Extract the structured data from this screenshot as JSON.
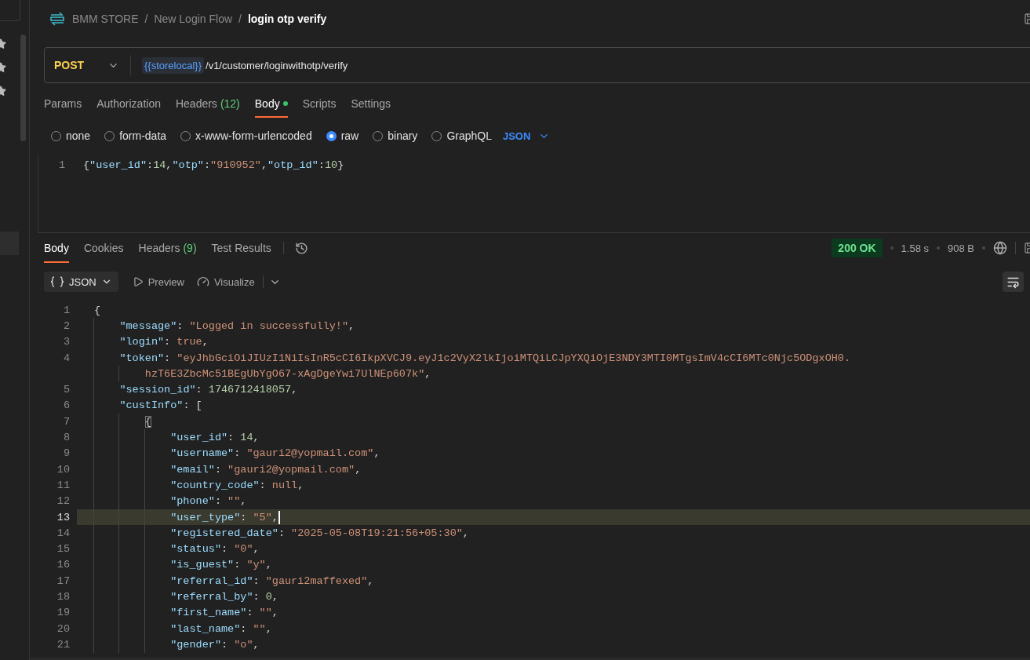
{
  "breadcrumb": [
    {
      "label": "BMM STORE",
      "current": false
    },
    {
      "separator": "/",
      "label": "New Login Flow",
      "current": false
    },
    {
      "separator": "/",
      "label": "login otp verify",
      "current": true
    }
  ],
  "request": {
    "method": "POST",
    "variable": "{{storelocal}}",
    "path": "/v1/customer/loginwithotp/verify"
  },
  "request_tabs": [
    {
      "label": "Params",
      "selected": false,
      "modified": false
    },
    {
      "label": "Authorization",
      "selected": false,
      "modified": false
    },
    {
      "label": "Headers",
      "count": "(12)",
      "selected": false,
      "modified": false
    },
    {
      "label": "Body",
      "selected": true,
      "modified": true
    },
    {
      "label": "Scripts",
      "selected": false,
      "modified": false
    },
    {
      "label": "Settings",
      "selected": false,
      "modified": false
    }
  ],
  "body_types": [
    {
      "label": "none",
      "selected": false
    },
    {
      "label": "form-data",
      "selected": false
    },
    {
      "label": "x-www-form-urlencoded",
      "selected": false
    },
    {
      "label": "raw",
      "selected": true
    },
    {
      "label": "binary",
      "selected": false
    },
    {
      "label": "GraphQL",
      "selected": false
    }
  ],
  "body_format": "JSON",
  "request_body": [
    {
      "number": "1",
      "tokens": [
        {
          "kind": "punct",
          "text": "{"
        },
        {
          "kind": "key",
          "text": "\"user_id\""
        },
        {
          "kind": "punct",
          "text": ":"
        },
        {
          "kind": "number",
          "text": "14"
        },
        {
          "kind": "punct",
          "text": ","
        },
        {
          "kind": "key",
          "text": "\"otp\""
        },
        {
          "kind": "punct",
          "text": ":"
        },
        {
          "kind": "string",
          "text": "\"910952\""
        },
        {
          "kind": "punct",
          "text": ","
        },
        {
          "kind": "key",
          "text": "\"otp_id\""
        },
        {
          "kind": "punct",
          "text": ":"
        },
        {
          "kind": "number",
          "text": "10"
        },
        {
          "kind": "punct",
          "text": "}"
        }
      ]
    }
  ],
  "response_tabs": [
    {
      "label": "Body",
      "selected": true
    },
    {
      "label": "Cookies",
      "selected": false
    },
    {
      "label": "Headers",
      "count": "(9)",
      "selected": false
    },
    {
      "label": "Test Results",
      "selected": false
    }
  ],
  "status": {
    "code": "200 OK",
    "time": "1.58 s",
    "size": "908 B"
  },
  "view": {
    "format": "JSON",
    "preview": "Preview",
    "visualize": "Visualize"
  },
  "response_lines": [
    {
      "number": "1",
      "current": false,
      "tokens": [
        {
          "kind": "punct",
          "text": "{"
        }
      ],
      "children": [
        {
          "number": "2",
          "current": false,
          "tokens": [
            {
              "kind": "key",
              "text": "\"message\""
            },
            {
              "kind": "punct",
              "text": ": "
            },
            {
              "kind": "string",
              "text": "\"Logged in successfully!\""
            },
            {
              "kind": "punct",
              "text": ","
            }
          ]
        },
        {
          "number": "3",
          "current": false,
          "tokens": [
            {
              "kind": "key",
              "text": "\"login\""
            },
            {
              "kind": "punct",
              "text": ": "
            },
            {
              "kind": "literal",
              "text": "true"
            },
            {
              "kind": "punct",
              "text": ","
            }
          ]
        },
        {
          "number": "4",
          "current": false,
          "tokens": [
            {
              "kind": "key",
              "text": "\"token\""
            },
            {
              "kind": "punct",
              "text": ": "
            },
            {
              "kind": "string",
              "text": "\"eyJhbGciOiJIUzI1NiIsInR5cCI6IkpXVCJ9.eyJ1c2VyX2lkIjoiMTQiLCJpYXQiOjE3NDY3MTI0MTgsImV4cCI6MTc0Njc5ODgxOH0."
            }
          ],
          "children": [
            {
              "current": false,
              "tokens": [
                {
                  "kind": "string",
                  "text": "hzT6E3ZbcMc51BEgUbYgO67-xAgDgeYwi7UlNEp607k\""
                },
                {
                  "kind": "punct",
                  "text": ","
                }
              ]
            }
          ]
        },
        {
          "number": "5",
          "current": false,
          "tokens": [
            {
              "kind": "key",
              "text": "\"session_id\""
            },
            {
              "kind": "punct",
              "text": ": "
            },
            {
              "kind": "number",
              "text": "1746712418057"
            },
            {
              "kind": "punct",
              "text": ","
            }
          ]
        },
        {
          "number": "6",
          "current": false,
          "tokens": [
            {
              "kind": "key",
              "text": "\"custInfo\""
            },
            {
              "kind": "punct",
              "text": ": ["
            }
          ],
          "children": [
            {
              "number": "7",
              "current": false,
              "tokens": [
                {
                  "kind": "bracket",
                  "text": "{"
                }
              ],
              "children": [
                {
                  "number": "8",
                  "current": false,
                  "tokens": [
                    {
                      "kind": "key",
                      "text": "\"user_id\""
                    },
                    {
                      "kind": "punct",
                      "text": ": "
                    },
                    {
                      "kind": "number",
                      "text": "14"
                    },
                    {
                      "kind": "punct",
                      "text": ","
                    }
                  ]
                },
                {
                  "number": "9",
                  "current": false,
                  "tokens": [
                    {
                      "kind": "key",
                      "text": "\"username\""
                    },
                    {
                      "kind": "punct",
                      "text": ": "
                    },
                    {
                      "kind": "string",
                      "text": "\"gauri2@yopmail.com\""
                    },
                    {
                      "kind": "punct",
                      "text": ","
                    }
                  ]
                },
                {
                  "number": "10",
                  "current": false,
                  "tokens": [
                    {
                      "kind": "key",
                      "text": "\"email\""
                    },
                    {
                      "kind": "punct",
                      "text": ": "
                    },
                    {
                      "kind": "string",
                      "text": "\"gauri2@yopmail.com\""
                    },
                    {
                      "kind": "punct",
                      "text": ","
                    }
                  ]
                },
                {
                  "number": "11",
                  "current": false,
                  "tokens": [
                    {
                      "kind": "key",
                      "text": "\"country_code\""
                    },
                    {
                      "kind": "punct",
                      "text": ": "
                    },
                    {
                      "kind": "literal",
                      "text": "null"
                    },
                    {
                      "kind": "punct",
                      "text": ","
                    }
                  ]
                },
                {
                  "number": "12",
                  "current": false,
                  "tokens": [
                    {
                      "kind": "key",
                      "text": "\"phone\""
                    },
                    {
                      "kind": "punct",
                      "text": ": "
                    },
                    {
                      "kind": "string",
                      "text": "\"\""
                    },
                    {
                      "kind": "punct",
                      "text": ","
                    }
                  ]
                },
                {
                  "number": "13",
                  "current": true,
                  "tokens": [
                    {
                      "kind": "key",
                      "text": "\"user_type\""
                    },
                    {
                      "kind": "punct",
                      "text": ": "
                    },
                    {
                      "kind": "string",
                      "text": "\"5\""
                    },
                    {
                      "kind": "punct",
                      "text": ","
                    }
                  ]
                },
                {
                  "number": "14",
                  "current": false,
                  "tokens": [
                    {
                      "kind": "key",
                      "text": "\"registered_date\""
                    },
                    {
                      "kind": "punct",
                      "text": ": "
                    },
                    {
                      "kind": "string",
                      "text": "\"2025-05-08T19:21:56+05:30\""
                    },
                    {
                      "kind": "punct",
                      "text": ","
                    }
                  ]
                },
                {
                  "number": "15",
                  "current": false,
                  "tokens": [
                    {
                      "kind": "key",
                      "text": "\"status\""
                    },
                    {
                      "kind": "punct",
                      "text": ": "
                    },
                    {
                      "kind": "string",
                      "text": "\"0\""
                    },
                    {
                      "kind": "punct",
                      "text": ","
                    }
                  ]
                },
                {
                  "number": "16",
                  "current": false,
                  "tokens": [
                    {
                      "kind": "key",
                      "text": "\"is_guest\""
                    },
                    {
                      "kind": "punct",
                      "text": ": "
                    },
                    {
                      "kind": "string",
                      "text": "\"y\""
                    },
                    {
                      "kind": "punct",
                      "text": ","
                    }
                  ]
                },
                {
                  "number": "17",
                  "current": false,
                  "tokens": [
                    {
                      "kind": "key",
                      "text": "\"referral_id\""
                    },
                    {
                      "kind": "punct",
                      "text": ": "
                    },
                    {
                      "kind": "string",
                      "text": "\"gauri2maffexed\""
                    },
                    {
                      "kind": "punct",
                      "text": ","
                    }
                  ]
                },
                {
                  "number": "18",
                  "current": false,
                  "tokens": [
                    {
                      "kind": "key",
                      "text": "\"referral_by\""
                    },
                    {
                      "kind": "punct",
                      "text": ": "
                    },
                    {
                      "kind": "number",
                      "text": "0"
                    },
                    {
                      "kind": "punct",
                      "text": ","
                    }
                  ]
                },
                {
                  "number": "19",
                  "current": false,
                  "tokens": [
                    {
                      "kind": "key",
                      "text": "\"first_name\""
                    },
                    {
                      "kind": "punct",
                      "text": ": "
                    },
                    {
                      "kind": "string",
                      "text": "\"\""
                    },
                    {
                      "kind": "punct",
                      "text": ","
                    }
                  ]
                },
                {
                  "number": "20",
                  "current": false,
                  "tokens": [
                    {
                      "kind": "key",
                      "text": "\"last_name\""
                    },
                    {
                      "kind": "punct",
                      "text": ": "
                    },
                    {
                      "kind": "string",
                      "text": "\"\""
                    },
                    {
                      "kind": "punct",
                      "text": ","
                    }
                  ]
                },
                {
                  "number": "21",
                  "current": false,
                  "tokens": [
                    {
                      "kind": "key",
                      "text": "\"gender\""
                    },
                    {
                      "kind": "punct",
                      "text": ": "
                    },
                    {
                      "kind": "string",
                      "text": "\"o\""
                    },
                    {
                      "kind": "punct",
                      "text": ","
                    }
                  ]
                }
              ]
            }
          ]
        }
      ]
    }
  ]
}
